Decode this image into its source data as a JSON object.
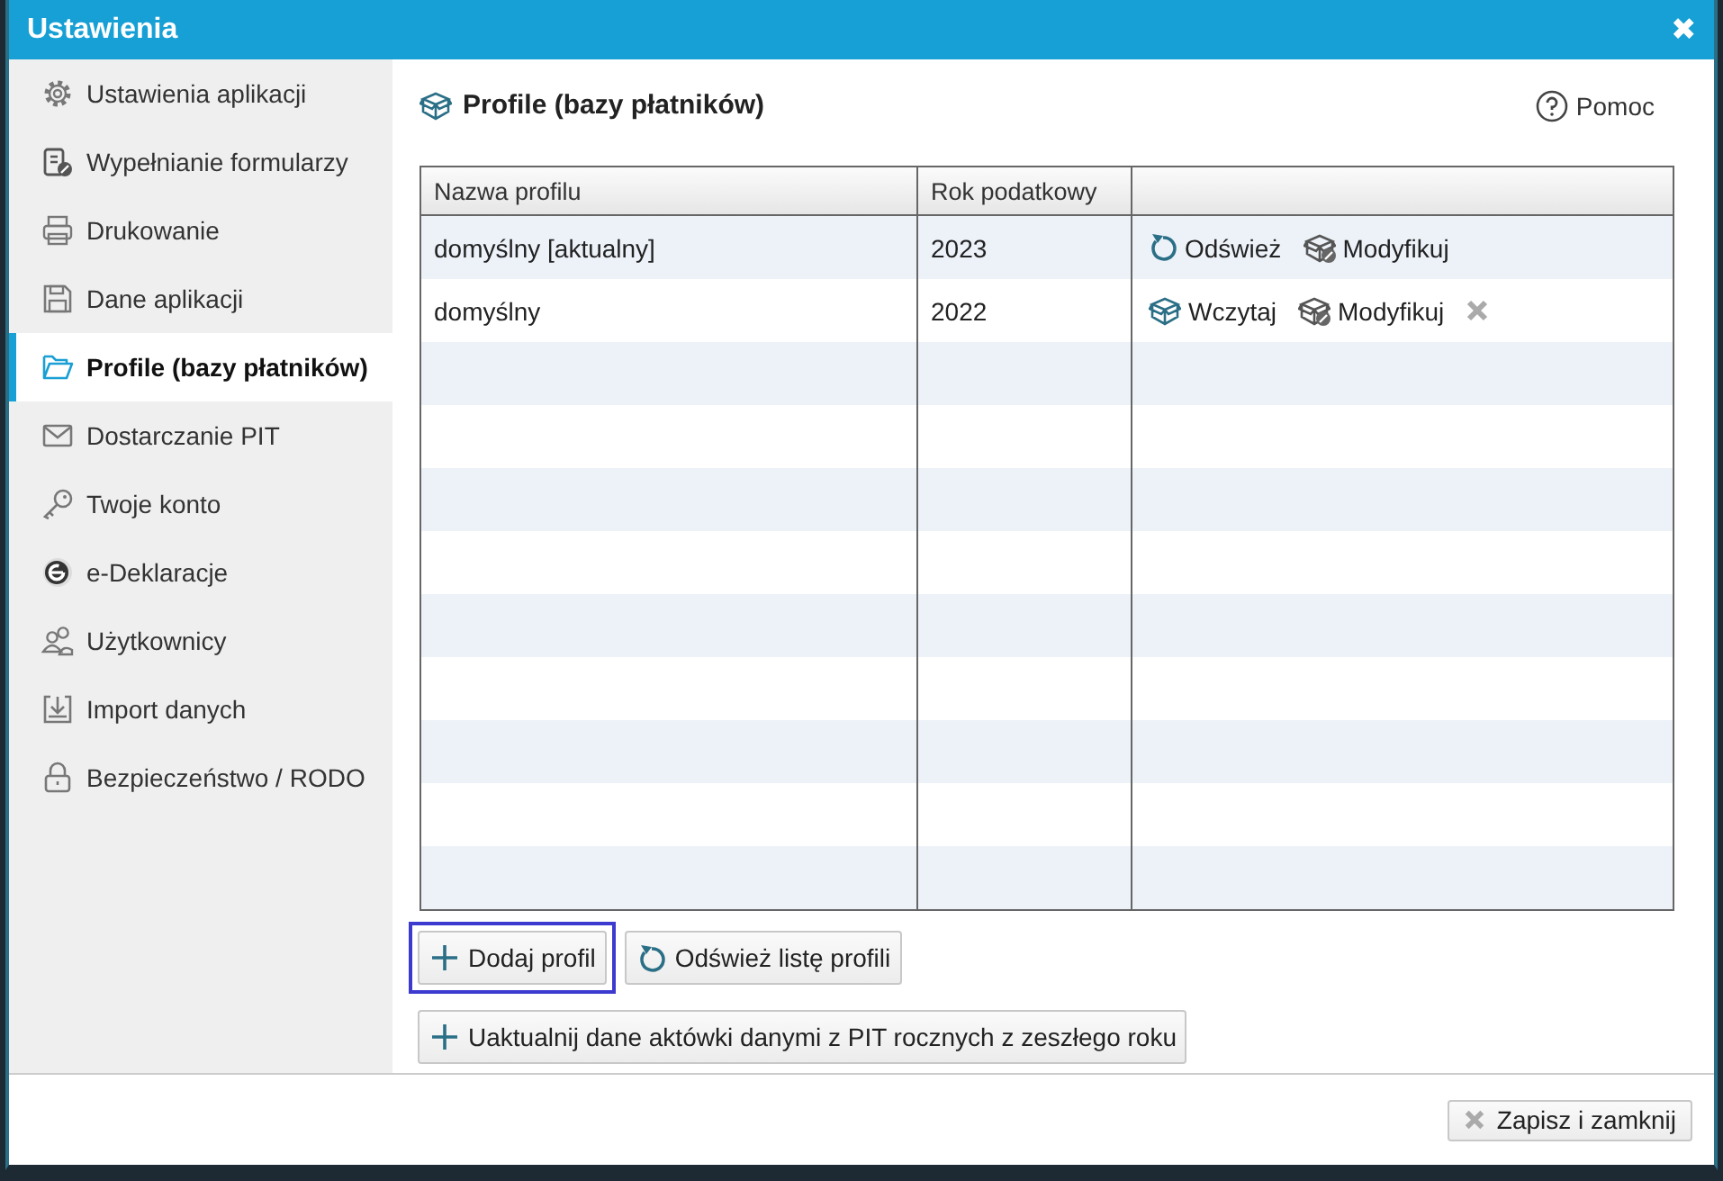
{
  "window": {
    "title": "Ustawienia",
    "close": "✖"
  },
  "sidebar": {
    "items": [
      {
        "label": "Ustawienia aplikacji",
        "kind": "gear",
        "selected": false
      },
      {
        "label": "Wypełnianie formularzy",
        "kind": "form",
        "selected": false
      },
      {
        "label": "Drukowanie",
        "kind": "printer",
        "selected": false
      },
      {
        "label": "Dane aplikacji",
        "kind": "floppy",
        "selected": false
      },
      {
        "label": "Profile (bazy płatników)",
        "kind": "folder",
        "selected": true
      },
      {
        "label": "Dostarczanie PIT",
        "kind": "envelope",
        "selected": false
      },
      {
        "label": "Twoje konto",
        "kind": "key",
        "selected": false
      },
      {
        "label": "e-Deklaracje",
        "kind": "e",
        "selected": false
      },
      {
        "label": "Użytkownicy",
        "kind": "users",
        "selected": false
      },
      {
        "label": "Import danych",
        "kind": "import",
        "selected": false
      },
      {
        "label": "Bezpieczeństwo / RODO",
        "kind": "lock",
        "selected": false
      }
    ]
  },
  "page": {
    "title": "Profile (bazy płatników)",
    "help": "Pomoc"
  },
  "table": {
    "columns": [
      "Nazwa profilu",
      "Rok podatkowy"
    ],
    "rows": [
      {
        "name": "domyślny [aktualny]",
        "year": "2023",
        "actions": [
          {
            "kind": "refresh",
            "label": "Odśwież"
          },
          {
            "kind": "modify",
            "label": "Modyfikuj"
          }
        ]
      },
      {
        "name": "domyślny",
        "year": "2022",
        "actions": [
          {
            "kind": "load",
            "label": "Wczytaj"
          },
          {
            "kind": "modify",
            "label": "Modyfikuj"
          },
          {
            "kind": "delete"
          }
        ]
      }
    ]
  },
  "buttons": [
    {
      "kind": "add",
      "label": "Dodaj profil",
      "focused": true
    },
    {
      "kind": "refresh",
      "label": "Odśwież listę profili",
      "focused": false
    },
    {
      "kind": "add",
      "label": "Uaktualnij dane aktówki danymi z PIT rocznych z zeszłego roku",
      "focused": false
    }
  ],
  "footer": {
    "save_button": "Zapisz i zamknij"
  }
}
